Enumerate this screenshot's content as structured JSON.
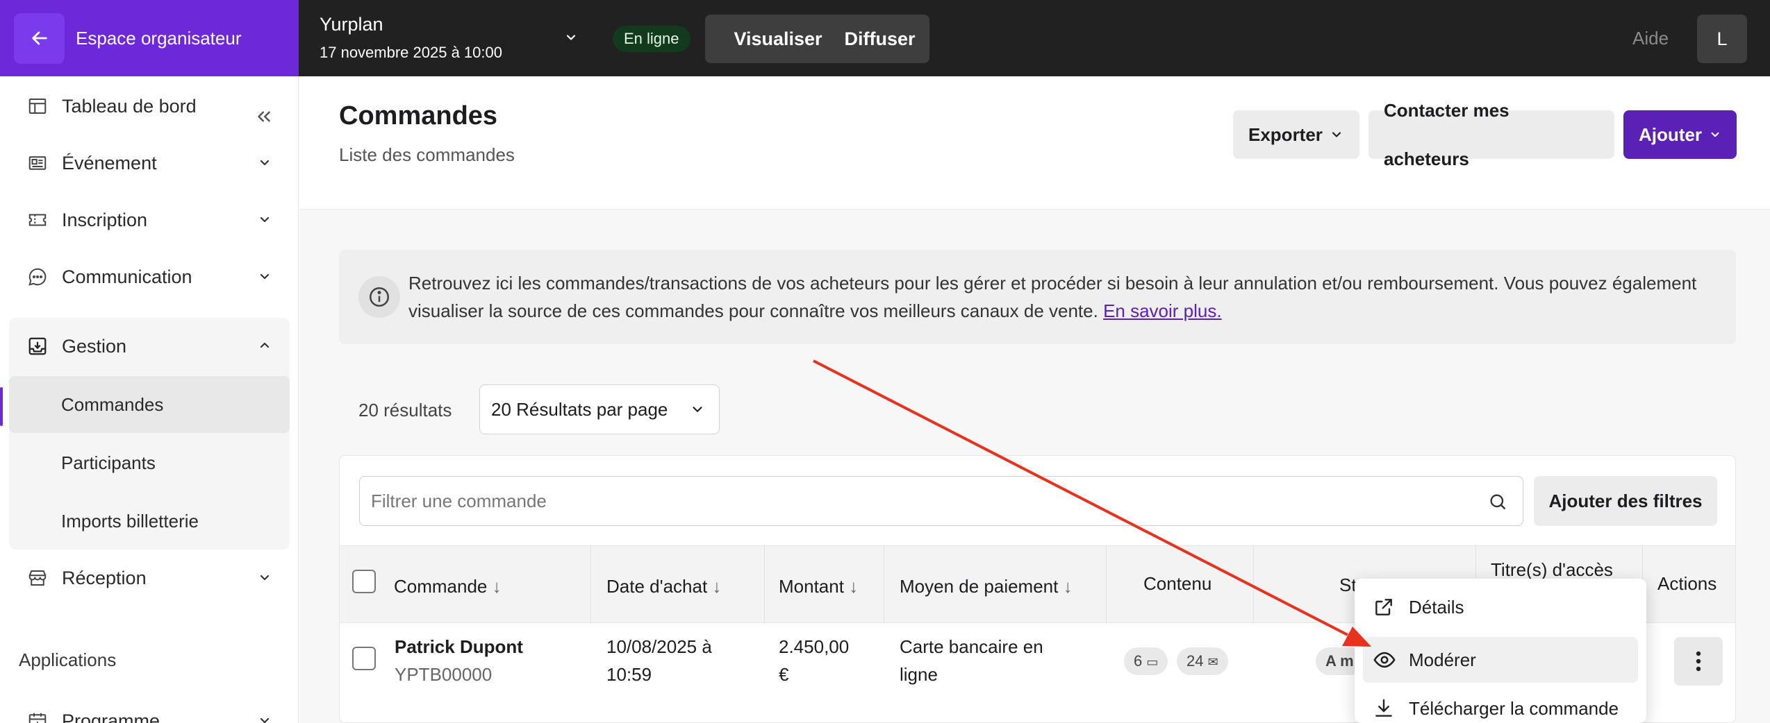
{
  "topbar": {
    "org_space_label": "Espace organisateur",
    "event_name": "Yurplan",
    "event_date": "17 novembre 2025 à 10:00",
    "status": "En ligne",
    "preview_label": "Visualiser",
    "publish_label": "Diffuser",
    "help_label": "Aide",
    "avatar_initial": "L"
  },
  "sidebar": {
    "items": [
      {
        "label": "Tableau de bord",
        "icon": "layout-icon"
      },
      {
        "label": "Événement",
        "icon": "news-icon"
      },
      {
        "label": "Inscription",
        "icon": "ticket-icon"
      },
      {
        "label": "Communication",
        "icon": "chat-icon"
      },
      {
        "label": "Gestion",
        "icon": "inbox-download-icon"
      },
      {
        "label": "Réception",
        "icon": "store-icon"
      }
    ],
    "gestion_sub": [
      "Commandes",
      "Participants",
      "Imports billetterie"
    ],
    "apps_title": "Applications",
    "apps_items": [
      {
        "label": "Programme",
        "icon": "calendar-plus-icon"
      }
    ]
  },
  "page": {
    "title": "Commandes",
    "subtitle": "Liste des commandes",
    "export_label": "Exporter",
    "contact_label": "Contacter mes acheteurs",
    "add_label": "Ajouter"
  },
  "info": {
    "text": "Retrouvez ici les commandes/transactions de vos acheteurs pour les gérer et procéder si besoin à leur annulation et/ou remboursement. Vous pouvez également visualiser la source de ces commandes pour connaître vos meilleurs canaux de vente. ",
    "link": "En savoir plus."
  },
  "results": {
    "count_label": "20 résultats",
    "per_page": "20 Résultats par page"
  },
  "filter": {
    "placeholder": "Filtrer une commande",
    "add_filters_label": "Ajouter des filtres"
  },
  "table": {
    "headers": {
      "order": "Commande",
      "date": "Date d'achat",
      "amount": "Montant",
      "payment": "Moyen de paiement",
      "content": "Contenu",
      "status": "St",
      "access": "Titre(s) d'accès",
      "actions": "Actions"
    },
    "rows": [
      {
        "name": "Patrick Dupont",
        "ref": "YPTB00000",
        "date_line1": "10/08/2025 à",
        "date_line2": "10:59",
        "amount_line1": "2.450,00",
        "amount_line2": "€",
        "payment_line1": "Carte bancaire en",
        "payment_line2": "ligne",
        "tickets": "6",
        "messages": "24",
        "status_partial": "A m"
      }
    ]
  },
  "menu": {
    "items": [
      "Détails",
      "Modérer",
      "Télécharger la commande"
    ]
  },
  "colors": {
    "brand": "#6d28d9",
    "primary_button": "#5b21b6",
    "topbar": "#212121",
    "arrow": "#e8321e"
  }
}
